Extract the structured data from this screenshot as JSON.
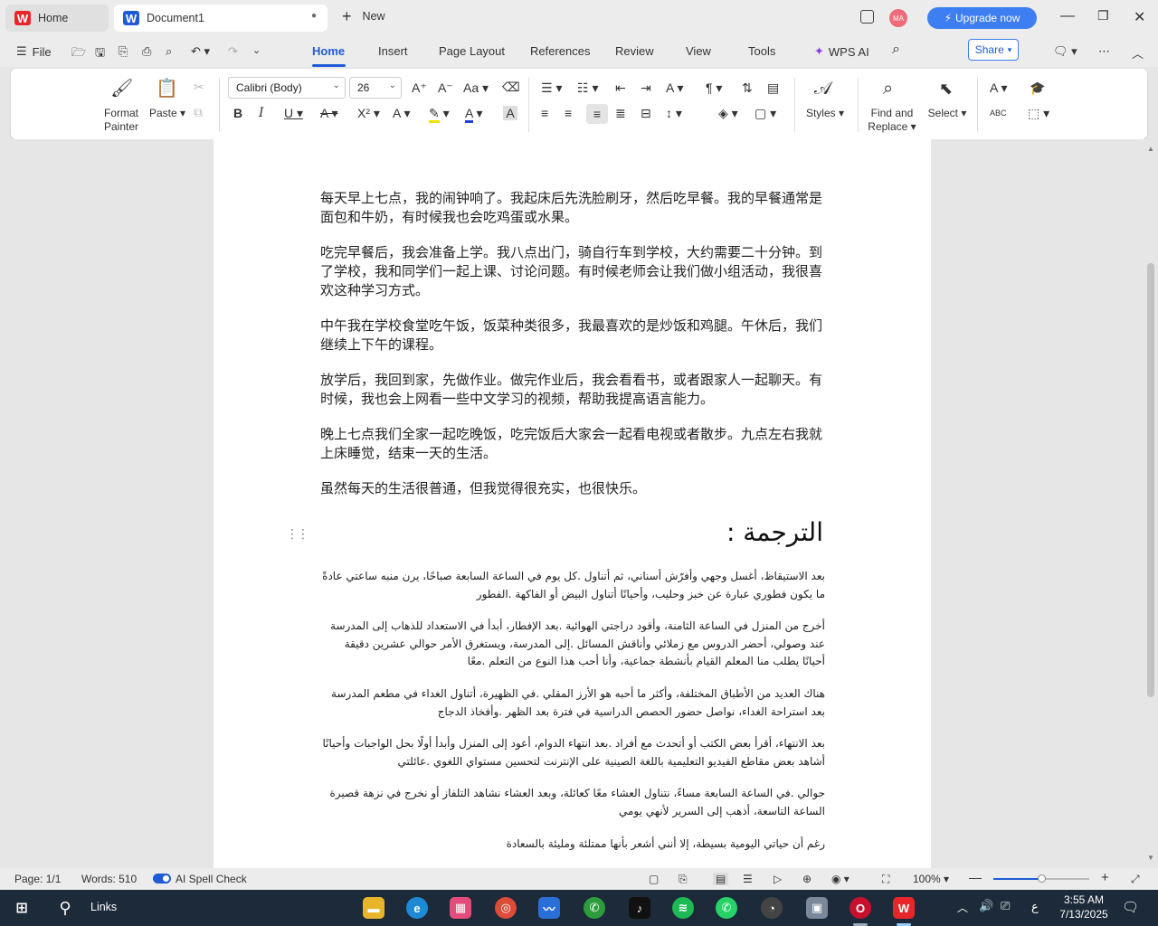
{
  "titlebar": {
    "home_tab": "Home",
    "doc_tab": "Document1",
    "new_tab": "New",
    "avatar": "MA",
    "upgrade": "Upgrade now"
  },
  "menu": {
    "file": "File",
    "tabs": [
      "Home",
      "Insert",
      "Page Layout",
      "References",
      "Review",
      "View",
      "Tools"
    ],
    "wps_ai": "WPS AI",
    "share": "Share"
  },
  "ribbon": {
    "format_painter": [
      "Format",
      "Painter"
    ],
    "paste": "Paste",
    "font_name": "Calibri (Body)",
    "font_size": "26",
    "styles": "Styles",
    "find_replace": [
      "Find and",
      "Replace"
    ],
    "select": "Select"
  },
  "document": {
    "chinese_paragraphs": [
      "每天早上七点，我的闹钟响了。我起床后先洗脸刷牙，然后吃早餐。我的早餐通常是面包和牛奶，有时候我也会吃鸡蛋或水果。",
      "吃完早餐后，我会准备上学。我八点出门，骑自行车到学校，大约需要二十分钟。到了学校，我和同学们一起上课、讨论问题。有时候老师会让我们做小组活动，我很喜欢这种学习方式。",
      "中午我在学校食堂吃午饭，饭菜种类很多，我最喜欢的是炒饭和鸡腿。午休后，我们继续上下午的课程。",
      "放学后，我回到家，先做作业。做完作业后，我会看看书，或者跟家人一起聊天。有时候，我也会上网看一些中文学习的视频，帮助我提高语言能力。",
      "晚上七点我们全家一起吃晚饭，吃完饭后大家会一起看电视或者散步。九点左右我就上床睡觉，结束一天的生活。",
      "虽然每天的生活很普通，但我觉得很充实，也很快乐。"
    ],
    "arabic_title": "الترجمة :",
    "arabic_paragraphs": [
      "بعد الاستيقاظ، أغسل وجهي وأفرّش أسناني، ثم أتناول   .كل يوم في الساعة السابعة صباحًا، يرن منبه ساعتي عادةً ما يكون فطوري عبارة عن خبز وحليب، وأحيانًا أتناول البيض أو الفاكهة .الفطور",
      "أخرج من المنزل في الساعة الثامنة، وأقود دراجتي الهوائية   .بعد الإفطار، أبدأ في الاستعداد للذهاب إلى المدرسة عند وصولي، أحضر الدروس مع زملائي وأناقش المسائل   .إلى المدرسة، ويستغرق الأمر حوالي عشرين دقيقة أحيانًا يطلب منا المعلم القيام بأنشطة جماعية، وأنا أحب هذا النوع من التعلم .معًا",
      "هناك العديد من الأطباق المختلفة، وأكثر ما أحبه هو الأرز المقلي   .في الظهيرة، أتناول الغداء في مطعم المدرسة بعد استراحة الغداء، نواصل حضور الحصص الدراسية في فترة بعد الظهر   .وأفخاذ الدجاج",
      "بعد الانتهاء، أقرأ بعض الكتب أو أتحدث مع أفراد   .بعد انتهاء الدوام، أعود إلى المنزل وأبدأ أولًا بحل الواجبات وأحيانًا أشاهد بعض مقاطع الفيديو التعليمية باللغة الصينية على الإنترنت لتحسين مستواي اللغوي   .عائلتي",
      "حوالي   .في الساعة السابعة مساءً، نتناول العشاء معًا كعائلة، وبعد العشاء نشاهد التلفاز أو نخرج في نزهة قصيرة الساعة التاسعة، أذهب إلى السرير لأنهي يومي",
      "رغم أن حياتي اليومية بسيطة، إلا أنني أشعر بأنها ممتلئة ومليئة بالسعادة"
    ]
  },
  "status": {
    "page": "Page: 1/1",
    "words": "Words: 510",
    "spell": "AI Spell Check",
    "zoom": "100%"
  },
  "taskbar": {
    "search": "Links",
    "time": "3:55 AM",
    "date": "7/13/2025",
    "lang": "ع"
  },
  "colors": {
    "accent": "#1f5bd6",
    "wps_red": "#e8262a",
    "upgrade": "#3d7ef2"
  }
}
